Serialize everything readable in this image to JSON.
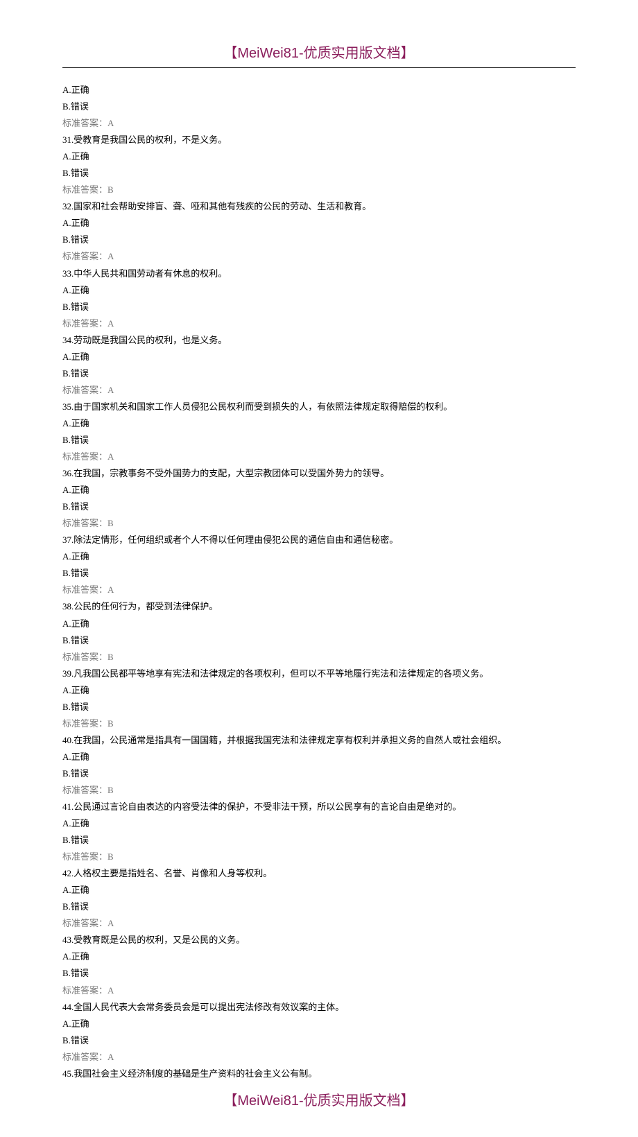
{
  "header": "【MeiWei81-优质实用版文档】",
  "footer": "【MeiWei81-优质实用版文档】",
  "items": [
    {
      "type": "opt",
      "text": "A.正确"
    },
    {
      "type": "opt",
      "text": "B.错误"
    },
    {
      "type": "ans",
      "text": "标准答案：A"
    },
    {
      "type": "q",
      "text": "31.受教育是我国公民的权利，不是义务。"
    },
    {
      "type": "opt",
      "text": "A.正确"
    },
    {
      "type": "opt",
      "text": "B.错误"
    },
    {
      "type": "ans",
      "text": "标准答案：B"
    },
    {
      "type": "q",
      "text": "32.国家和社会帮助安排盲、聋、哑和其他有残疾的公民的劳动、生活和教育。"
    },
    {
      "type": "opt",
      "text": "A.正确"
    },
    {
      "type": "opt",
      "text": "B.错误"
    },
    {
      "type": "ans",
      "text": "标准答案：A"
    },
    {
      "type": "q",
      "text": "33.中华人民共和国劳动者有休息的权利。"
    },
    {
      "type": "opt",
      "text": "A.正确"
    },
    {
      "type": "opt",
      "text": "B.错误"
    },
    {
      "type": "ans",
      "text": "标准答案：A"
    },
    {
      "type": "q",
      "text": "34.劳动既是我国公民的权利，也是义务。"
    },
    {
      "type": "opt",
      "text": "A.正确"
    },
    {
      "type": "opt",
      "text": "B.错误"
    },
    {
      "type": "ans",
      "text": "标准答案：A"
    },
    {
      "type": "q",
      "text": "35.由于国家机关和国家工作人员侵犯公民权利而受到损失的人，有依照法律规定取得赔偿的权利。"
    },
    {
      "type": "opt",
      "text": "A.正确"
    },
    {
      "type": "opt",
      "text": "B.错误"
    },
    {
      "type": "ans",
      "text": "标准答案：A"
    },
    {
      "type": "q",
      "text": "36.在我国，宗教事务不受外国势力的支配，大型宗教团体可以受国外势力的领导。"
    },
    {
      "type": "opt",
      "text": "A.正确"
    },
    {
      "type": "opt",
      "text": "B.错误"
    },
    {
      "type": "ans",
      "text": "标准答案：B"
    },
    {
      "type": "q",
      "text": "37.除法定情形，任何组织或者个人不得以任何理由侵犯公民的通信自由和通信秘密。"
    },
    {
      "type": "opt",
      "text": "A.正确"
    },
    {
      "type": "opt",
      "text": "B.错误"
    },
    {
      "type": "ans",
      "text": "标准答案：A"
    },
    {
      "type": "q",
      "text": "38.公民的任何行为，都受到法律保护。"
    },
    {
      "type": "opt",
      "text": "A.正确"
    },
    {
      "type": "opt",
      "text": "B.错误"
    },
    {
      "type": "ans",
      "text": "标准答案：B"
    },
    {
      "type": "q",
      "text": "39.凡我国公民都平等地享有宪法和法律规定的各项权利，但可以不平等地履行宪法和法律规定的各项义务。"
    },
    {
      "type": "opt",
      "text": "A.正确"
    },
    {
      "type": "opt",
      "text": "B.错误"
    },
    {
      "type": "ans",
      "text": "标准答案：B"
    },
    {
      "type": "q",
      "text": "40.在我国，公民通常是指具有一国国籍，并根据我国宪法和法律规定享有权利并承担义务的自然人或社会组织。"
    },
    {
      "type": "opt",
      "text": "A.正确"
    },
    {
      "type": "opt",
      "text": "B.错误"
    },
    {
      "type": "ans",
      "text": "标准答案：B"
    },
    {
      "type": "q",
      "text": "41.公民通过言论自由表达的内容受法律的保护，不受非法干预，所以公民享有的言论自由是绝对的。"
    },
    {
      "type": "opt",
      "text": "A.正确"
    },
    {
      "type": "opt",
      "text": "B.错误"
    },
    {
      "type": "ans",
      "text": "标准答案：B"
    },
    {
      "type": "q",
      "text": "42.人格权主要是指姓名、名誉、肖像和人身等权利。"
    },
    {
      "type": "opt",
      "text": "A.正确"
    },
    {
      "type": "opt",
      "text": "B.错误"
    },
    {
      "type": "ans",
      "text": "标准答案：A"
    },
    {
      "type": "q",
      "text": "43.受教育既是公民的权利，又是公民的义务。"
    },
    {
      "type": "opt",
      "text": "A.正确"
    },
    {
      "type": "opt",
      "text": "B.错误"
    },
    {
      "type": "ans",
      "text": "标准答案：A"
    },
    {
      "type": "q",
      "text": "44.全国人民代表大会常务委员会是可以提出宪法修改有效议案的主体。"
    },
    {
      "type": "opt",
      "text": "A.正确"
    },
    {
      "type": "opt",
      "text": "B.错误"
    },
    {
      "type": "ans",
      "text": "标准答案：A"
    },
    {
      "type": "q",
      "text": "45.我国社会主义经济制度的基础是生产资料的社会主义公有制。"
    }
  ]
}
